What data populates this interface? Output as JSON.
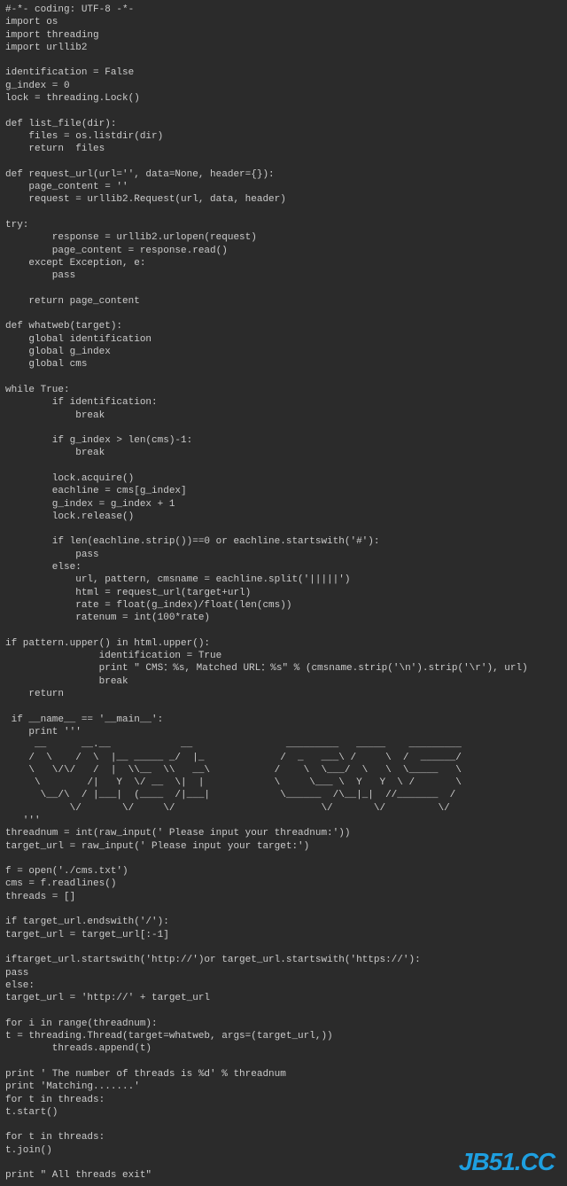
{
  "code": "#-*- coding: UTF-8 -*-\nimport os\nimport threading\nimport urllib2\n\nidentification = False\ng_index = 0\nlock = threading.Lock()\n\ndef list_file(dir):\n    files = os.listdir(dir)\n    return  files\n\ndef request_url(url='', data=None, header={}):\n    page_content = ''\n    request = urllib2.Request(url, data, header)\n\ntry:\n        response = urllib2.urlopen(request)\n        page_content = response.read()\n    except Exception, e:\n        pass\n\n    return page_content\n\ndef whatweb(target):\n    global identification\n    global g_index\n    global cms\n\nwhile True:\n        if identification:\n            break\n\n        if g_index > len(cms)-1:\n            break\n\n        lock.acquire()\n        eachline = cms[g_index]\n        g_index = g_index + 1\n        lock.release()\n\n        if len(eachline.strip())==0 or eachline.startswith('#'):\n            pass\n        else:\n            url, pattern, cmsname = eachline.split('|||||')\n            html = request_url(target+url)\n            rate = float(g_index)/float(len(cms))\n            ratenum = int(100*rate)\n\nif pattern.upper() in html.upper():\n                identification = True\n                print \" CMS：%s, Matched URL：%s\" % (cmsname.strip('\\n').strip('\\r'), url)\n                break\n    return\n\n if __name__ == '__main__':\n    print '''",
  "ascii_art": "     __      __.__            __                _________   _____    _________\n    /  \\    /  \\  |__ _____ _/  |_             /  _   ___\\ /     \\  /  ______/\n    \\   \\/\\/   /  |  \\\\__  \\\\   __\\           /    \\  \\___/  \\   \\  \\_____   \\\n     \\        /|   Y  \\/ __  \\|  |            \\     \\___ \\  Y   Y  \\ /       \\\n      \\__/\\  / |___|  (____  /|___|            \\______  /\\__|_|  //_______  /\n           \\/       \\/     \\/                         \\/       \\/         \\/",
  "code_after": "   '''\nthreadnum = int(raw_input(' Please input your threadnum:'))\ntarget_url = raw_input(' Please input your target:')\n\nf = open('./cms.txt')\ncms = f.readlines()\nthreads = []\n\nif target_url.endswith('/'):\ntarget_url = target_url[:-1]\n\niftarget_url.startswith('http://')or target_url.startswith('https://'):\npass\nelse:\ntarget_url = 'http://' + target_url\n\nfor i in range(threadnum):\nt = threading.Thread(target=whatweb, args=(target_url,))\n        threads.append(t)\n\nprint ' The number of threads is %d' % threadnum\nprint 'Matching.......'\nfor t in threads:\nt.start()\n\nfor t in threads:\nt.join()\n\nprint \" All threads exit\"",
  "watermark": "JB51.CC"
}
